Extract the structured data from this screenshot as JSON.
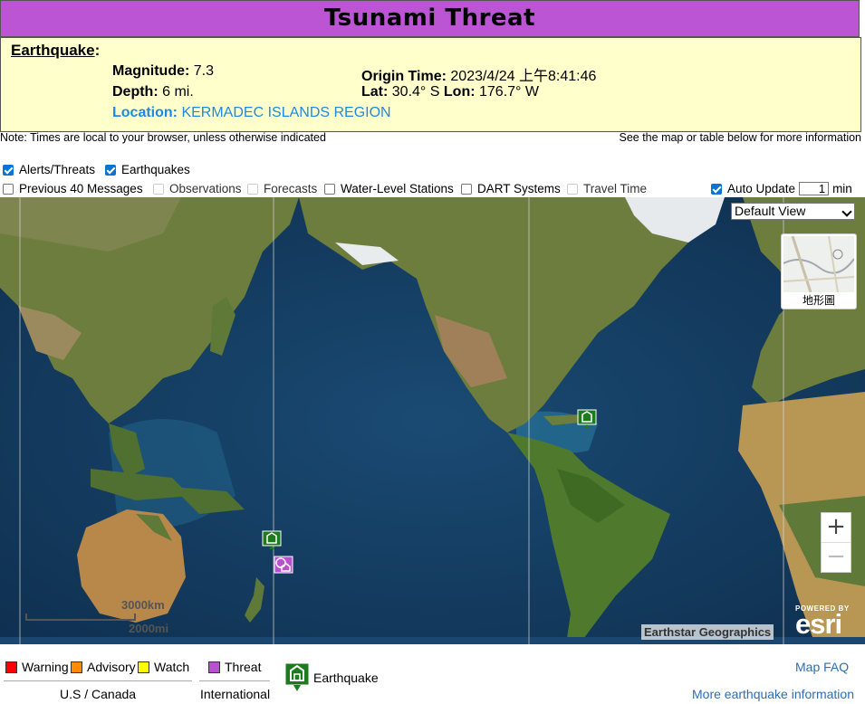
{
  "header": {
    "title": "Tsunami Threat"
  },
  "earthquake": {
    "heading": "Earthquake",
    "magnitude_label": "Magnitude:",
    "magnitude": "7.3",
    "depth_label": "Depth:",
    "depth": "6 mi.",
    "origin_label": "Origin Time:",
    "origin": "2023/4/24 上午8:41:46",
    "lat_label": "Lat:",
    "lat": "30.4° S",
    "lon_label": "Lon:",
    "lon": "176.7° W",
    "location_label": "Location:",
    "location": "KERMADEC ISLANDS REGION"
  },
  "notes": {
    "left": "Note: Times are local to your browser, unless otherwise indicated",
    "right": "See the map or table below for more information"
  },
  "options": {
    "alerts": "Alerts/Threats",
    "earthquakes": "Earthquakes",
    "previous": "Previous 40 Messages",
    "observations": "Observations",
    "forecasts": "Forecasts",
    "water_level": "Water-Level Stations",
    "dart": "DART Systems",
    "travel_time": "Travel Time",
    "auto_update": "Auto Update",
    "auto_update_value": "1",
    "auto_update_unit": "min"
  },
  "map": {
    "view_select": "Default View",
    "basemap_label": "地形圖",
    "zoom_in": "+",
    "zoom_out": "−",
    "scale_km": "3000km",
    "scale_mi": "2000mi",
    "attribution": "Earthstar Geographics",
    "esri_powered": "POWERED BY",
    "esri_name": "esri",
    "colors": {
      "ocean": "#123a5c",
      "land": "#6d7d3e",
      "threat": "#b94fd1",
      "marker_green": "#1e7a1e"
    }
  },
  "legend": {
    "warning": "Warning",
    "advisory": "Advisory",
    "watch": "Watch",
    "us_canada": "U.S / Canada",
    "threat": "Threat",
    "international": "International",
    "earthquake": "Earthquake",
    "colors": {
      "warning": "#ff0000",
      "advisory": "#ff8c00",
      "watch": "#ffff00",
      "threat": "#b94fd1"
    }
  },
  "links": {
    "faq": "Map FAQ",
    "more_info": "More earthquake information"
  }
}
